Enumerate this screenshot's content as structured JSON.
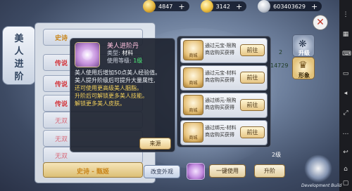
{
  "resources": [
    {
      "icon": "gold-coin-icon",
      "value": "4847"
    },
    {
      "icon": "gold-ingot-icon",
      "value": "3142"
    },
    {
      "icon": "silver-coin-icon",
      "value": "603403629"
    }
  ],
  "side_title": {
    "chars": [
      "美",
      "人",
      "进",
      "阶"
    ]
  },
  "left_list": [
    {
      "label": "史诗",
      "tone": "gold"
    },
    {
      "label": "传说",
      "tone": "red"
    },
    {
      "label": "传说",
      "tone": "red"
    },
    {
      "label": "传说",
      "tone": "red"
    },
    {
      "label": "无双",
      "tone": "dim"
    },
    {
      "label": "无双",
      "tone": "dim"
    },
    {
      "label": "无双",
      "tone": "dim"
    }
  ],
  "left_bottom": {
    "label": "史诗 - 甄姬"
  },
  "tooltip": {
    "name": "美人进阶丹",
    "type_label": "类型:",
    "type_value": "材料",
    "level_label": "使用等级:",
    "level_value": "1级",
    "desc": [
      {
        "text": "美人使用后增加50点美人经验值。",
        "tone": "white"
      },
      {
        "text": "美人提升阶级后可提升大量属性,",
        "tone": "white"
      },
      {
        "text": "还可使用更高级美人胭脂。",
        "tone": "yellow"
      },
      {
        "text": "升阶后可解锁更多美人技能。",
        "tone": "yellow"
      },
      {
        "text": "解锁更多美人皮肤。",
        "tone": "yellow"
      }
    ],
    "source_button": "来源"
  },
  "sources": [
    {
      "icon_text": "商城",
      "line1": "通过元宝-限购",
      "line2": "商店购买获得",
      "button": "前往"
    },
    {
      "icon_text": "商城",
      "line1": "通过元宝-材料",
      "line2": "商店购买获得",
      "button": "前往"
    },
    {
      "icon_text": "商城",
      "line1": "通过绑元-限购",
      "line2": "商店购买获得",
      "button": "前往"
    },
    {
      "icon_text": "商城",
      "line1": "通过绑元-材料",
      "line2": "商店购买获得",
      "button": "前往"
    }
  ],
  "side_tabs": [
    {
      "icon": "upgrade-icon",
      "label": "升级"
    },
    {
      "icon": "appearance-icon",
      "label": "形象"
    }
  ],
  "side_numbers": {
    "n1": "2",
    "n2": "14729"
  },
  "bottom": {
    "change_look": "改变外观",
    "one_click_use": "一键使用",
    "advance": "升阶",
    "level": "2级"
  },
  "dev_build": "Development Build",
  "colors": {
    "accent_gold": "#e3cfa0",
    "name_pink": "#ffc2e0",
    "level_green": "#4ef07a",
    "highlight_yellow": "#f3d15a"
  }
}
